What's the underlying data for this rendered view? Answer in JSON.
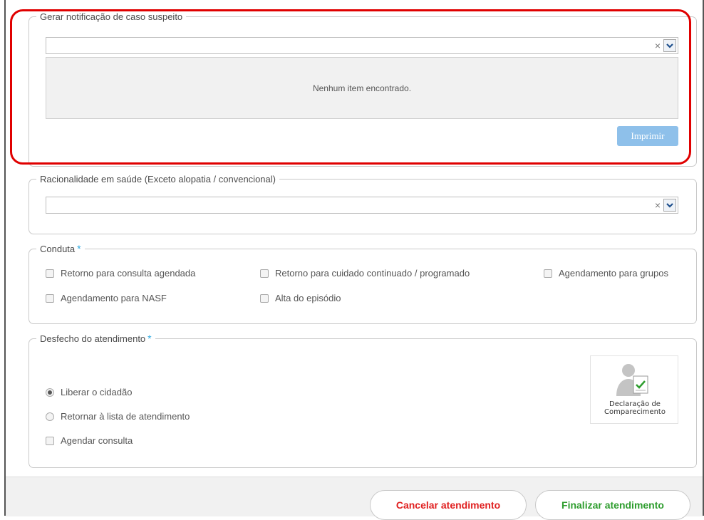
{
  "notificacao": {
    "legend": "Gerar notificação de caso suspeito",
    "select_clear": "×",
    "empty_text": "Nenhum item encontrado.",
    "print_label": "Imprimir"
  },
  "racionalidade": {
    "legend": "Racionalidade em saúde (Exceto alopatia / convencional)",
    "select_clear": "×"
  },
  "conduta": {
    "legend": "Conduta",
    "required_mark": "*",
    "options": [
      "Retorno para consulta agendada",
      "Retorno para cuidado continuado / programado",
      "Agendamento para grupos",
      "Agendamento para NASF",
      "Alta do episódio"
    ]
  },
  "desfecho": {
    "legend": "Desfecho do atendimento",
    "required_mark": "*",
    "radio_liberar": "Liberar o cidadão",
    "radio_retornar": "Retornar à lista de atendimento",
    "checkbox_agendar": "Agendar consulta",
    "declaracao_line1": "Declaração de",
    "declaracao_line2": "Comparecimento"
  },
  "footer": {
    "cancel_label": "Cancelar atendimento",
    "finish_label": "Finalizar atendimento"
  },
  "colors": {
    "highlight": "#e00000",
    "cancel_text": "#e02020",
    "finish_text": "#2e9d2e",
    "print_button": "#8ec0ea",
    "required": "#2aa8e0"
  }
}
